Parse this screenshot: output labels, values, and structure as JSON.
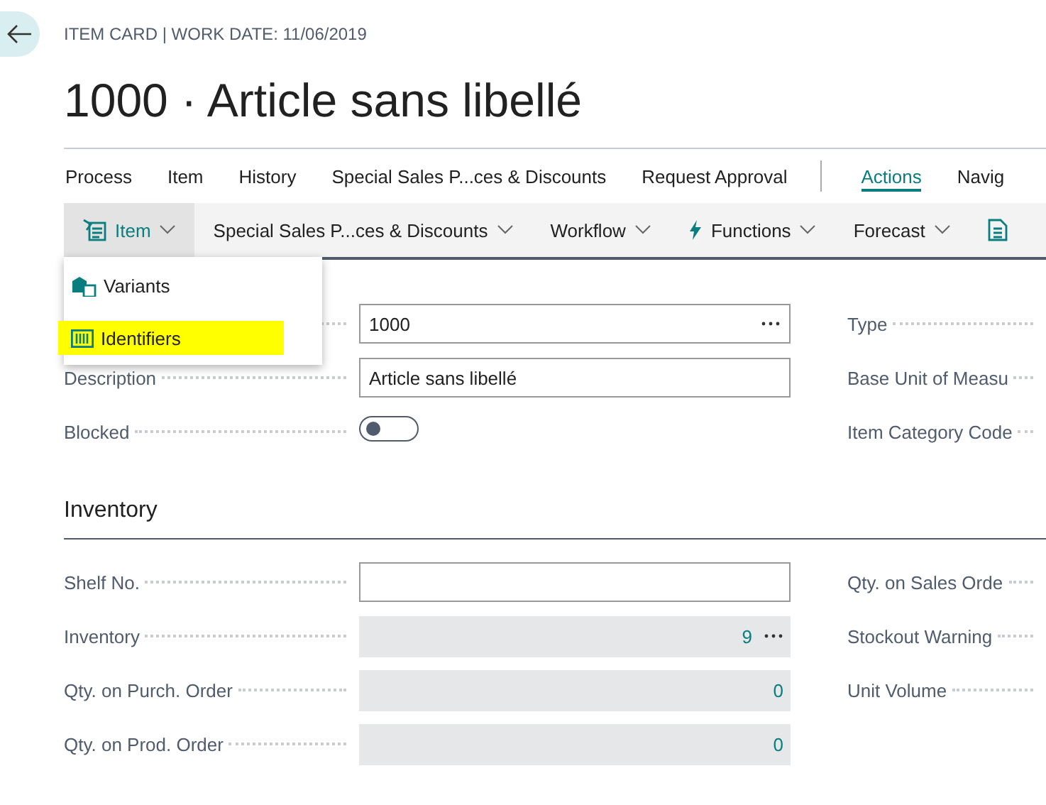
{
  "breadcrumb": "ITEM CARD | WORK DATE: 11/06/2019",
  "title": "1000 · Article sans libellé",
  "tabs": [
    {
      "label": "Process",
      "selected": false
    },
    {
      "label": "Item",
      "selected": false
    },
    {
      "label": "History",
      "selected": false
    },
    {
      "label": "Special Sales P...ces & Discounts",
      "selected": false
    },
    {
      "label": "Request Approval",
      "selected": false
    },
    {
      "label": "Actions",
      "selected": true
    },
    {
      "label": "Navig",
      "selected": false
    }
  ],
  "actions": [
    {
      "label": "Item",
      "kind": "card",
      "expanded": true
    },
    {
      "label": "Special Sales P...ces & Discounts",
      "kind": "plain",
      "expanded": false
    },
    {
      "label": "Workflow",
      "kind": "plain",
      "expanded": false
    },
    {
      "label": "Functions",
      "kind": "bolt",
      "expanded": false
    },
    {
      "label": "Forecast",
      "kind": "plain",
      "expanded": false
    },
    {
      "kind": "document",
      "expanded": false
    }
  ],
  "menu": [
    {
      "label": "Variants",
      "kind": "variants",
      "highlighted": false
    },
    {
      "label": "Identifiers",
      "kind": "barcode",
      "highlighted": true
    }
  ],
  "general": {
    "rows": [
      {
        "kind": "lookup",
        "value": "1000",
        "right_label": "Type"
      },
      {
        "label": "Description",
        "kind": "input",
        "value": "Article sans libellé",
        "right_label": "Base Unit of Measu"
      },
      {
        "label": "Blocked",
        "kind": "toggle",
        "on": false,
        "right_label": "Item Category Code"
      }
    ]
  },
  "inventory": {
    "heading": "Inventory",
    "rows": [
      {
        "label": "Shelf No.",
        "kind": "input",
        "right_label": "Qty. on Sales Orde"
      },
      {
        "label": "Inventory",
        "kind": "readonly",
        "value": "9",
        "lookup": true,
        "right_label": "Stockout Warning"
      },
      {
        "label": "Qty. on Purch. Order",
        "kind": "readonly",
        "value": "0",
        "lookup": false,
        "right_label": "Unit Volume"
      },
      {
        "label": "Qty. on Prod. Order",
        "kind": "readonly",
        "value": "0",
        "lookup": false
      }
    ]
  }
}
